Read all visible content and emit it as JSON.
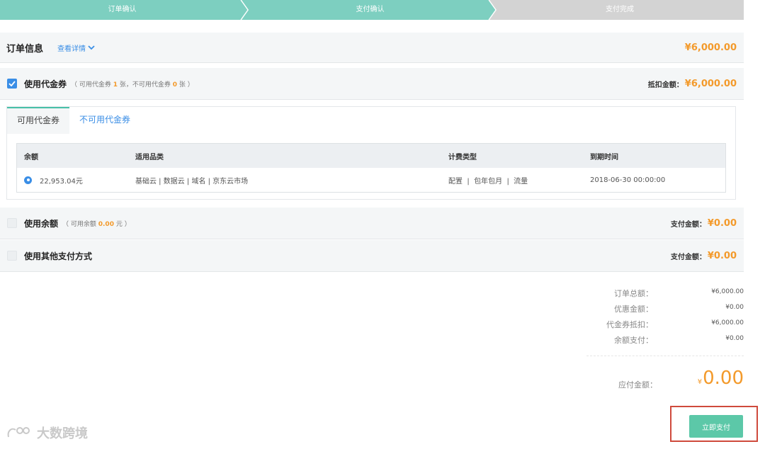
{
  "steps": [
    {
      "label": "订单确认",
      "state": "done"
    },
    {
      "label": "支付确认",
      "state": "active"
    },
    {
      "label": "支付完成",
      "state": "pending"
    }
  ],
  "colors": {
    "step_active": "#7dcfc0",
    "step_pending": "#d3d3d3",
    "accent": "#3a8ee6",
    "amount": "#f39a2b",
    "pay_button": "#5cc8a8",
    "highlight_frame": "#cf4a3c"
  },
  "order": {
    "title": "订单信息",
    "detail_link": "查看详情",
    "detail_icon": "chevron-down-icon",
    "amount": "¥6,000.00"
  },
  "voucher": {
    "checked": true,
    "title": "使用代金券",
    "hint_prefix": "（ 可用代金券 ",
    "available_count": "1",
    "hint_mid": " 张，不可用代金券 ",
    "unavailable_count": "0",
    "hint_suffix": " 张 ）",
    "deduct_label": "抵扣金额：",
    "deduct_amount": "¥6,000.00",
    "tabs": [
      {
        "label": "可用代金券",
        "active": true
      },
      {
        "label": "不可用代金券",
        "active": false
      }
    ],
    "table": {
      "headers": [
        "余额",
        "适用品类",
        "计费类型",
        "到期时间"
      ],
      "rows": [
        {
          "selected": true,
          "balance": "22,953.04元",
          "categories": "基础云 | 数据云 | 域名 | 京东云市场",
          "billing": "配置  |  包年包月  |  流量",
          "expires": "2018-06-30 00:00:00"
        }
      ]
    }
  },
  "balance": {
    "checked": false,
    "title": "使用余额",
    "hint_prefix": "（ 可用余额 ",
    "available": "0.00",
    "hint_suffix": " 元 ）",
    "pay_label": "支付金额：",
    "pay_amount": "¥0.00"
  },
  "other": {
    "checked": false,
    "title": "使用其他支付方式",
    "pay_label": "支付金额：",
    "pay_amount": "¥0.00"
  },
  "summary": {
    "rows": [
      {
        "label": "订单总额：",
        "value": "¥6,000.00"
      },
      {
        "label": "优惠金额：",
        "value": "¥0.00"
      },
      {
        "label": "代金券抵扣：",
        "value": "¥6,000.00"
      },
      {
        "label": "余额支付：",
        "value": "¥0.00"
      }
    ],
    "payable_label": "应付金额：",
    "payable_symbol": "¥",
    "payable_value": "0.00"
  },
  "pay_button": {
    "label": "立即支付"
  },
  "watermark": {
    "text": "大数跨境"
  }
}
